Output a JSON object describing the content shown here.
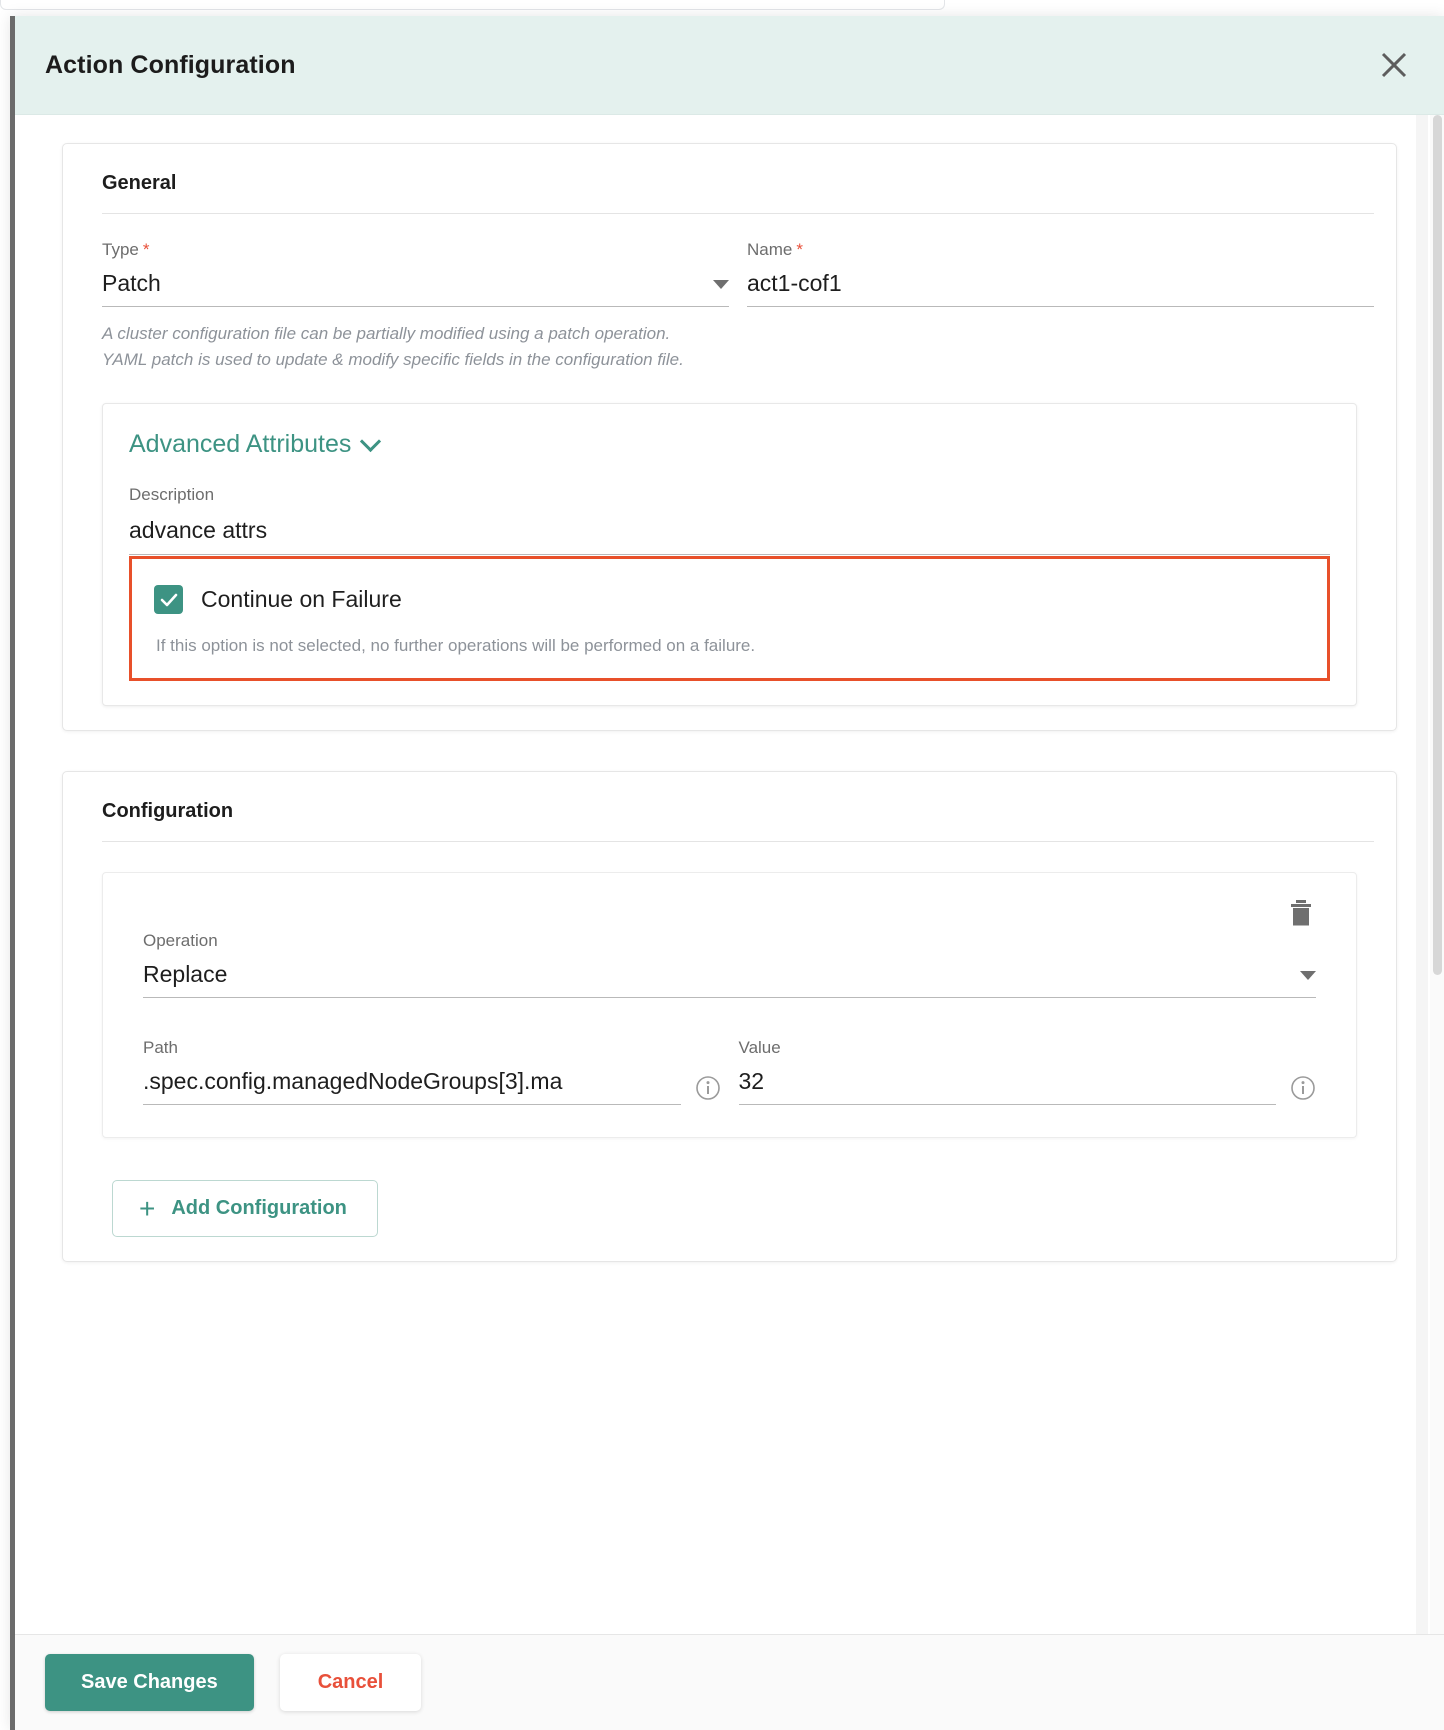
{
  "header": {
    "title": "Action Configuration",
    "close_icon": "close-icon"
  },
  "general": {
    "section_title": "General",
    "type": {
      "label": "Type",
      "required_marker": "*",
      "value": "Patch",
      "caret_icon": "chevron-down-icon",
      "hint": "A cluster configuration file can be partially modified using a patch operation. YAML patch is used to update & modify specific fields in the configuration file."
    },
    "name": {
      "label": "Name",
      "required_marker": "*",
      "value": "act1-cof1"
    },
    "advanced": {
      "toggle_label": "Advanced Attributes",
      "toggle_icon": "chevron-down-icon",
      "description_label": "Description",
      "description_value": "advance attrs",
      "continue_on_failure": {
        "label": "Continue on Failure",
        "checked": true,
        "check_icon": "check-icon",
        "help": "If this option is not selected, no further operations will be performed on a failure."
      }
    }
  },
  "configuration": {
    "section_title": "Configuration",
    "delete_icon": "trash-icon",
    "operation": {
      "label": "Operation",
      "value": "Replace",
      "caret_icon": "chevron-down-icon"
    },
    "path": {
      "label": "Path",
      "value": ".spec.config.managedNodeGroups[3].ma",
      "info_icon": "info-icon"
    },
    "value": {
      "label": "Value",
      "value": "32",
      "info_icon": "info-icon"
    },
    "add_button": {
      "label": "Add Configuration",
      "plus_icon": "plus-icon",
      "plus_glyph": "+"
    }
  },
  "footer": {
    "save_label": "Save Changes",
    "cancel_label": "Cancel"
  },
  "colors": {
    "accent_teal": "#3d9383",
    "header_bg": "#e4f1ee",
    "danger_red": "#e8503a",
    "highlight_border": "#e8502a"
  }
}
